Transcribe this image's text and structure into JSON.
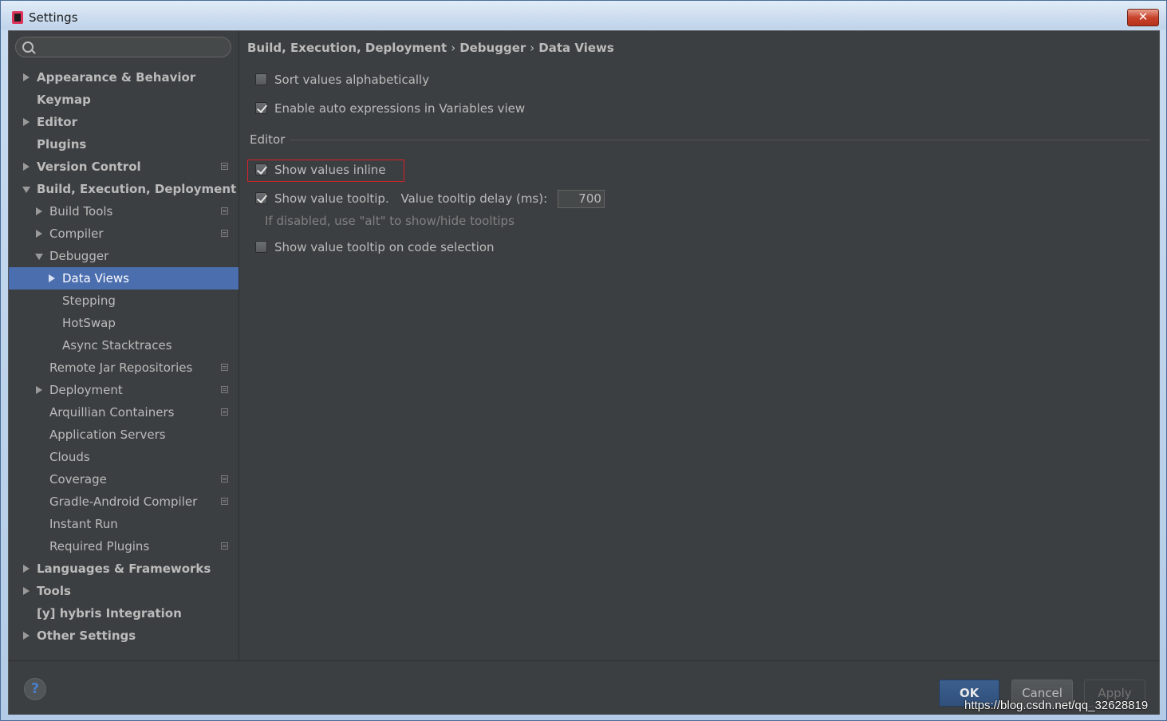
{
  "window": {
    "title": "Settings",
    "close_label": "✕"
  },
  "search": {
    "placeholder": "",
    "value": ""
  },
  "sidebar": {
    "items": [
      {
        "label": "Appearance & Behavior",
        "level": 0,
        "expander": "collapsed",
        "bold": true,
        "project": false
      },
      {
        "label": "Keymap",
        "level": 0,
        "expander": "none",
        "bold": true,
        "project": false
      },
      {
        "label": "Editor",
        "level": 0,
        "expander": "collapsed",
        "bold": true,
        "project": false
      },
      {
        "label": "Plugins",
        "level": 0,
        "expander": "none",
        "bold": true,
        "project": false
      },
      {
        "label": "Version Control",
        "level": 0,
        "expander": "collapsed",
        "bold": true,
        "project": true
      },
      {
        "label": "Build, Execution, Deployment",
        "level": 0,
        "expander": "expanded",
        "bold": true,
        "project": false
      },
      {
        "label": "Build Tools",
        "level": 1,
        "expander": "collapsed",
        "bold": false,
        "project": true
      },
      {
        "label": "Compiler",
        "level": 1,
        "expander": "collapsed",
        "bold": false,
        "project": true
      },
      {
        "label": "Debugger",
        "level": 1,
        "expander": "expanded",
        "bold": false,
        "project": false
      },
      {
        "label": "Data Views",
        "level": 2,
        "expander": "collapsed",
        "bold": false,
        "project": false,
        "selected": true
      },
      {
        "label": "Stepping",
        "level": 2,
        "expander": "none",
        "bold": false,
        "project": false
      },
      {
        "label": "HotSwap",
        "level": 2,
        "expander": "none",
        "bold": false,
        "project": false
      },
      {
        "label": "Async Stacktraces",
        "level": 2,
        "expander": "none",
        "bold": false,
        "project": false
      },
      {
        "label": "Remote Jar Repositories",
        "level": 1,
        "expander": "none",
        "bold": false,
        "project": true
      },
      {
        "label": "Deployment",
        "level": 1,
        "expander": "collapsed",
        "bold": false,
        "project": true
      },
      {
        "label": "Arquillian Containers",
        "level": 1,
        "expander": "none",
        "bold": false,
        "project": true
      },
      {
        "label": "Application Servers",
        "level": 1,
        "expander": "none",
        "bold": false,
        "project": false
      },
      {
        "label": "Clouds",
        "level": 1,
        "expander": "none",
        "bold": false,
        "project": false
      },
      {
        "label": "Coverage",
        "level": 1,
        "expander": "none",
        "bold": false,
        "project": true
      },
      {
        "label": "Gradle-Android Compiler",
        "level": 1,
        "expander": "none",
        "bold": false,
        "project": true
      },
      {
        "label": "Instant Run",
        "level": 1,
        "expander": "none",
        "bold": false,
        "project": false
      },
      {
        "label": "Required Plugins",
        "level": 1,
        "expander": "none",
        "bold": false,
        "project": true
      },
      {
        "label": "Languages & Frameworks",
        "level": 0,
        "expander": "collapsed",
        "bold": true,
        "project": false
      },
      {
        "label": "Tools",
        "level": 0,
        "expander": "collapsed",
        "bold": true,
        "project": false
      },
      {
        "label": "[y] hybris Integration",
        "level": 0,
        "expander": "none",
        "bold": true,
        "project": false
      },
      {
        "label": "Other Settings",
        "level": 0,
        "expander": "collapsed",
        "bold": true,
        "project": false
      }
    ]
  },
  "breadcrumb": {
    "parts": [
      "Build, Execution, Deployment",
      "Debugger",
      "Data Views"
    ],
    "separator": "›"
  },
  "options": {
    "sort_alphabetically": {
      "label": "Sort values alphabetically",
      "checked": false
    },
    "auto_expressions": {
      "label": "Enable auto expressions in Variables view",
      "checked": true
    },
    "editor_section": "Editor",
    "show_inline": {
      "label": "Show values inline",
      "checked": true
    },
    "show_tooltip": {
      "label": "Show value tooltip.",
      "checked": true
    },
    "tooltip_delay_label": "Value tooltip delay (ms):",
    "tooltip_delay_value": "700",
    "tooltip_hint": "If disabled, use \"alt\" to show/hide tooltips",
    "tooltip_on_selection": {
      "label": "Show value tooltip on code selection",
      "checked": false
    }
  },
  "footer": {
    "help_label": "?",
    "ok_label": "OK",
    "cancel_label": "Cancel",
    "apply_label": "Apply"
  },
  "watermark": "https://blog.csdn.net/qq_32628819",
  "colors": {
    "background": "#3c3f41",
    "selection": "#4b6eaf",
    "text": "#bbbbbb",
    "highlight_box": "#d3222a"
  }
}
